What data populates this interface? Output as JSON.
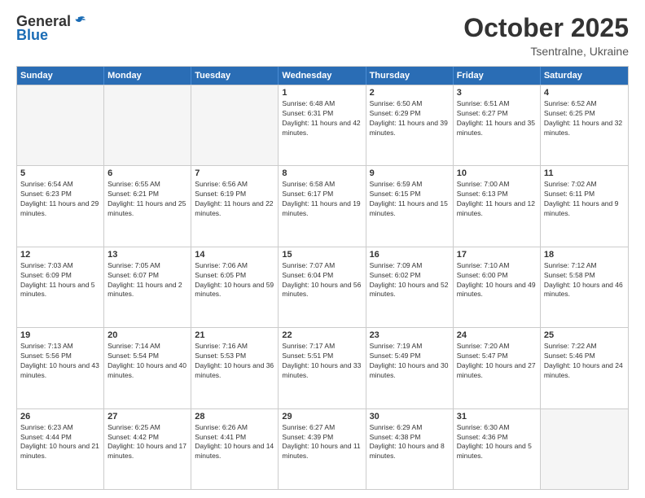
{
  "logo": {
    "general": "General",
    "blue": "Blue"
  },
  "title": "October 2025",
  "location": "Tsentralne, Ukraine",
  "days": [
    "Sunday",
    "Monday",
    "Tuesday",
    "Wednesday",
    "Thursday",
    "Friday",
    "Saturday"
  ],
  "rows": [
    [
      {
        "day": "",
        "content": ""
      },
      {
        "day": "",
        "content": ""
      },
      {
        "day": "",
        "content": ""
      },
      {
        "day": "1",
        "sunrise": "6:48 AM",
        "sunset": "6:31 PM",
        "daylight": "11 hours and 42 minutes."
      },
      {
        "day": "2",
        "sunrise": "6:50 AM",
        "sunset": "6:29 PM",
        "daylight": "11 hours and 39 minutes."
      },
      {
        "day": "3",
        "sunrise": "6:51 AM",
        "sunset": "6:27 PM",
        "daylight": "11 hours and 35 minutes."
      },
      {
        "day": "4",
        "sunrise": "6:52 AM",
        "sunset": "6:25 PM",
        "daylight": "11 hours and 32 minutes."
      }
    ],
    [
      {
        "day": "5",
        "sunrise": "6:54 AM",
        "sunset": "6:23 PM",
        "daylight": "11 hours and 29 minutes."
      },
      {
        "day": "6",
        "sunrise": "6:55 AM",
        "sunset": "6:21 PM",
        "daylight": "11 hours and 25 minutes."
      },
      {
        "day": "7",
        "sunrise": "6:56 AM",
        "sunset": "6:19 PM",
        "daylight": "11 hours and 22 minutes."
      },
      {
        "day": "8",
        "sunrise": "6:58 AM",
        "sunset": "6:17 PM",
        "daylight": "11 hours and 19 minutes."
      },
      {
        "day": "9",
        "sunrise": "6:59 AM",
        "sunset": "6:15 PM",
        "daylight": "11 hours and 15 minutes."
      },
      {
        "day": "10",
        "sunrise": "7:00 AM",
        "sunset": "6:13 PM",
        "daylight": "11 hours and 12 minutes."
      },
      {
        "day": "11",
        "sunrise": "7:02 AM",
        "sunset": "6:11 PM",
        "daylight": "11 hours and 9 minutes."
      }
    ],
    [
      {
        "day": "12",
        "sunrise": "7:03 AM",
        "sunset": "6:09 PM",
        "daylight": "11 hours and 5 minutes."
      },
      {
        "day": "13",
        "sunrise": "7:05 AM",
        "sunset": "6:07 PM",
        "daylight": "11 hours and 2 minutes."
      },
      {
        "day": "14",
        "sunrise": "7:06 AM",
        "sunset": "6:05 PM",
        "daylight": "10 hours and 59 minutes."
      },
      {
        "day": "15",
        "sunrise": "7:07 AM",
        "sunset": "6:04 PM",
        "daylight": "10 hours and 56 minutes."
      },
      {
        "day": "16",
        "sunrise": "7:09 AM",
        "sunset": "6:02 PM",
        "daylight": "10 hours and 52 minutes."
      },
      {
        "day": "17",
        "sunrise": "7:10 AM",
        "sunset": "6:00 PM",
        "daylight": "10 hours and 49 minutes."
      },
      {
        "day": "18",
        "sunrise": "7:12 AM",
        "sunset": "5:58 PM",
        "daylight": "10 hours and 46 minutes."
      }
    ],
    [
      {
        "day": "19",
        "sunrise": "7:13 AM",
        "sunset": "5:56 PM",
        "daylight": "10 hours and 43 minutes."
      },
      {
        "day": "20",
        "sunrise": "7:14 AM",
        "sunset": "5:54 PM",
        "daylight": "10 hours and 40 minutes."
      },
      {
        "day": "21",
        "sunrise": "7:16 AM",
        "sunset": "5:53 PM",
        "daylight": "10 hours and 36 minutes."
      },
      {
        "day": "22",
        "sunrise": "7:17 AM",
        "sunset": "5:51 PM",
        "daylight": "10 hours and 33 minutes."
      },
      {
        "day": "23",
        "sunrise": "7:19 AM",
        "sunset": "5:49 PM",
        "daylight": "10 hours and 30 minutes."
      },
      {
        "day": "24",
        "sunrise": "7:20 AM",
        "sunset": "5:47 PM",
        "daylight": "10 hours and 27 minutes."
      },
      {
        "day": "25",
        "sunrise": "7:22 AM",
        "sunset": "5:46 PM",
        "daylight": "10 hours and 24 minutes."
      }
    ],
    [
      {
        "day": "26",
        "sunrise": "6:23 AM",
        "sunset": "4:44 PM",
        "daylight": "10 hours and 21 minutes."
      },
      {
        "day": "27",
        "sunrise": "6:25 AM",
        "sunset": "4:42 PM",
        "daylight": "10 hours and 17 minutes."
      },
      {
        "day": "28",
        "sunrise": "6:26 AM",
        "sunset": "4:41 PM",
        "daylight": "10 hours and 14 minutes."
      },
      {
        "day": "29",
        "sunrise": "6:27 AM",
        "sunset": "4:39 PM",
        "daylight": "10 hours and 11 minutes."
      },
      {
        "day": "30",
        "sunrise": "6:29 AM",
        "sunset": "4:38 PM",
        "daylight": "10 hours and 8 minutes."
      },
      {
        "day": "31",
        "sunrise": "6:30 AM",
        "sunset": "4:36 PM",
        "daylight": "10 hours and 5 minutes."
      },
      {
        "day": "",
        "content": ""
      }
    ]
  ]
}
